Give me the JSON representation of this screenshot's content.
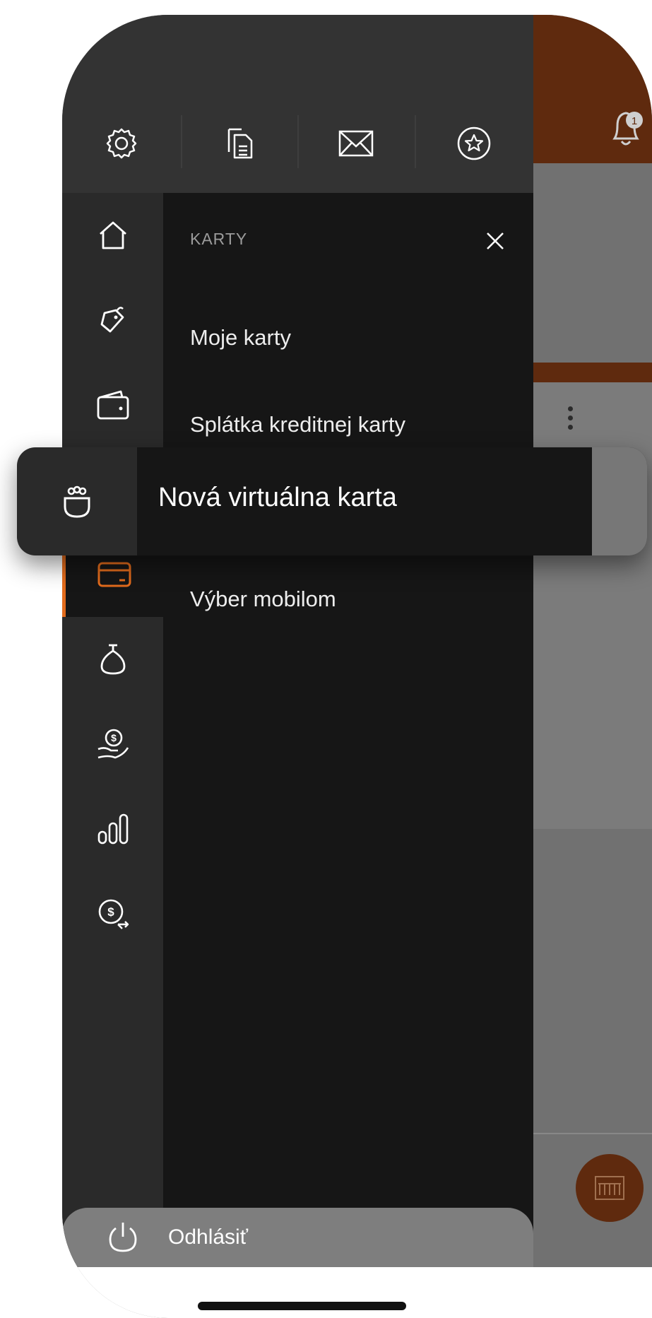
{
  "drawer": {
    "section_title": "KARTY",
    "items": [
      {
        "label": "Moje karty"
      },
      {
        "label": "Splátka kreditnej karty"
      },
      {
        "label": "Nová virtuálna karta"
      },
      {
        "label": "Výber mobilom"
      }
    ],
    "logout_label": "Odhlásiť"
  },
  "background": {
    "notification_count": "1"
  },
  "colors": {
    "accent": "#e26b1c",
    "header_brown": "#5f2a0e",
    "drawer_dark": "#161616",
    "rail": "#2a2a2a"
  },
  "icons": {
    "top": [
      "settings-icon",
      "documents-icon",
      "mail-icon",
      "favorites-icon"
    ],
    "rail": [
      "home-icon",
      "tag-icon",
      "wallet-icon",
      "piggy-bank-icon",
      "card-icon",
      "money-bag-icon",
      "hand-money-icon",
      "bar-chart-icon",
      "exchange-icon"
    ]
  }
}
